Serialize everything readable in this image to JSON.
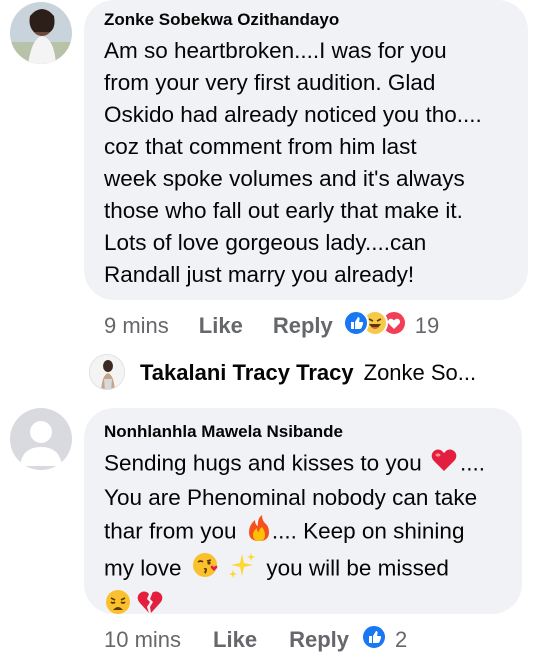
{
  "comments": [
    {
      "author": "Zonke Sobekwa Ozithandayo",
      "lines": [
        "Am so heartbroken....I was for you",
        "from your very first audition. Glad",
        "Oskido had already noticed you tho....",
        "coz that comment from him last",
        "week spoke volumes and it's always",
        "those who fall out early that make it.",
        "Lots of love gorgeous lady....can",
        "Randall just marry you already!"
      ],
      "time": "9 mins",
      "like_label": "Like",
      "reply_label": "Reply",
      "reaction_count": "19",
      "reactions": [
        "like-icon",
        "haha-icon",
        "love-icon"
      ]
    },
    {
      "author": "Nonhlanhla Mawela Nsibande",
      "line1": "Sending hugs and kisses to you",
      "line1_tail": "....",
      "line2": "You are Phenominal nobody can take",
      "line3a": "thar from you",
      "line3b": ".... Keep on shining",
      "line4a": "my love",
      "line4b": "you will be missed",
      "time": "10 mins",
      "like_label": "Like",
      "reply_label": "Reply",
      "reaction_count": "2",
      "reactions": [
        "like-icon"
      ]
    }
  ],
  "reply_preview": {
    "author": "Takalani Tracy Tracy",
    "snippet": "Zonke So..."
  },
  "colors": {
    "bubble": "#f0f2f5",
    "meta": "#65676b",
    "like_blue": "#1877f2",
    "heart_red": "#e41e3f"
  }
}
